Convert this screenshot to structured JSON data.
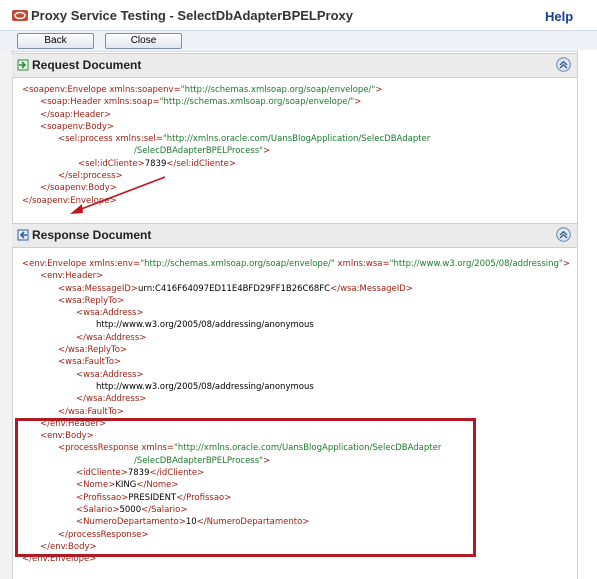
{
  "window": {
    "title": "Proxy Service Testing - SelectDbAdapterBPELProxy",
    "help_label": "Help",
    "logo_icon": "oracle-logo-icon"
  },
  "buttons": {
    "back_label": "Back",
    "close_label": "Close"
  },
  "request": {
    "section_title": "Request Document",
    "icon": "request-arrow-icon",
    "lines": [
      {
        "tag": "<soapenv:Envelope ",
        "attr": "xmlns:soapenv=",
        "val": "\"http://schemas.xmlsoap.org/soap/envelope/\"",
        "end": ">"
      },
      {
        "tag": "<soap:Header ",
        "attr": "xmlns:soap=",
        "val": "\"http://schemas.xmlsoap.org/soap/envelope/\"",
        "end": ">"
      },
      {
        "tag": "</soap:Header>",
        "attr": "",
        "val": "",
        "end": ""
      },
      {
        "tag": "<soapenv:Body>",
        "attr": "",
        "val": "",
        "end": ""
      },
      {
        "tag": "<sel:process ",
        "attr": "xmlns:sel=",
        "val": "\"http://xmlns.oracle.com/UansBlogApplication/SelecDBAdapter",
        "end": ""
      },
      {
        "tag": "",
        "attr": "",
        "val": "/SelecDBAdapterBPELProcess\"",
        "end": ">"
      },
      {
        "tag": "<sel:idCliente>",
        "attr": "",
        "val": "",
        "txt": "7839",
        "end": "</sel:idCliente>"
      },
      {
        "tag": "</sel:process>",
        "attr": "",
        "val": "",
        "end": ""
      },
      {
        "tag": "</soapenv:Body>",
        "attr": "",
        "val": "",
        "end": ""
      },
      {
        "tag": "</soapenv:Envelope>",
        "attr": "",
        "val": "",
        "end": ""
      }
    ]
  },
  "response": {
    "section_title": "Response Document",
    "icon": "response-arrow-icon",
    "lines": [
      {
        "tag": "<env:Envelope ",
        "attr": "xmlns:env=",
        "val": "\"http://schemas.xmlsoap.org/soap/envelope/\"",
        "attr2": " xmlns:wsa=",
        "val2": "\"http://www.w3.org/2005/08/addressing\"",
        "end": ">"
      },
      {
        "tag": "<env:Header>",
        "end": ""
      },
      {
        "tag": "<wsa:MessageID>",
        "txt": "urn:C416F64097ED11E4BFD29FF1B26C68FC",
        "end": "</wsa:MessageID>"
      },
      {
        "tag": "<wsa:ReplyTo>",
        "end": ""
      },
      {
        "tag": "<wsa:Address>",
        "end": ""
      },
      {
        "tag": "",
        "txt": "http://www.w3.org/2005/08/addressing/anonymous",
        "end": ""
      },
      {
        "tag": "</wsa:Address>",
        "end": ""
      },
      {
        "tag": "</wsa:ReplyTo>",
        "end": ""
      },
      {
        "tag": "<wsa:FaultTo>",
        "end": ""
      },
      {
        "tag": "<wsa:Address>",
        "end": ""
      },
      {
        "tag": "",
        "txt": "http://www.w3.org/2005/08/addressing/anonymous",
        "end": ""
      },
      {
        "tag": "</wsa:Address>",
        "end": ""
      },
      {
        "tag": "</wsa:FaultTo>",
        "end": ""
      },
      {
        "tag": "</env:Header>",
        "end": ""
      },
      {
        "tag": "<env:Body>",
        "end": ""
      },
      {
        "tag": "<processResponse ",
        "attr": "xmlns=",
        "val": "\"http://xmlns.oracle.com/UansBlogApplication/SelecDBAdapter",
        "end": ""
      },
      {
        "tag": "",
        "val": "/SelecDBAdapterBPELProcess\"",
        "end": ">"
      },
      {
        "tag": "<idCliente>",
        "txt": "7839",
        "end": "</idCliente>"
      },
      {
        "tag": "<Nome>",
        "txt": "KING",
        "end": "</Nome>"
      },
      {
        "tag": "<Profissao>",
        "txt": "PRESIDENT",
        "end": "</Profissao>"
      },
      {
        "tag": "<Salario>",
        "txt": "5000",
        "end": "</Salario>"
      },
      {
        "tag": "<NumeroDepartamento>",
        "txt": "10",
        "end": "</NumeroDepartamento>"
      },
      {
        "tag": "</processResponse>",
        "end": ""
      },
      {
        "tag": "</env:Body>",
        "end": ""
      },
      {
        "tag": "</env:Envelope>",
        "end": ""
      }
    ]
  },
  "colors": {
    "tag": "#9b1d0f",
    "value": "#1d7a2e",
    "highlight": "#b01a22",
    "annotation_arrow": "#c0161e"
  }
}
